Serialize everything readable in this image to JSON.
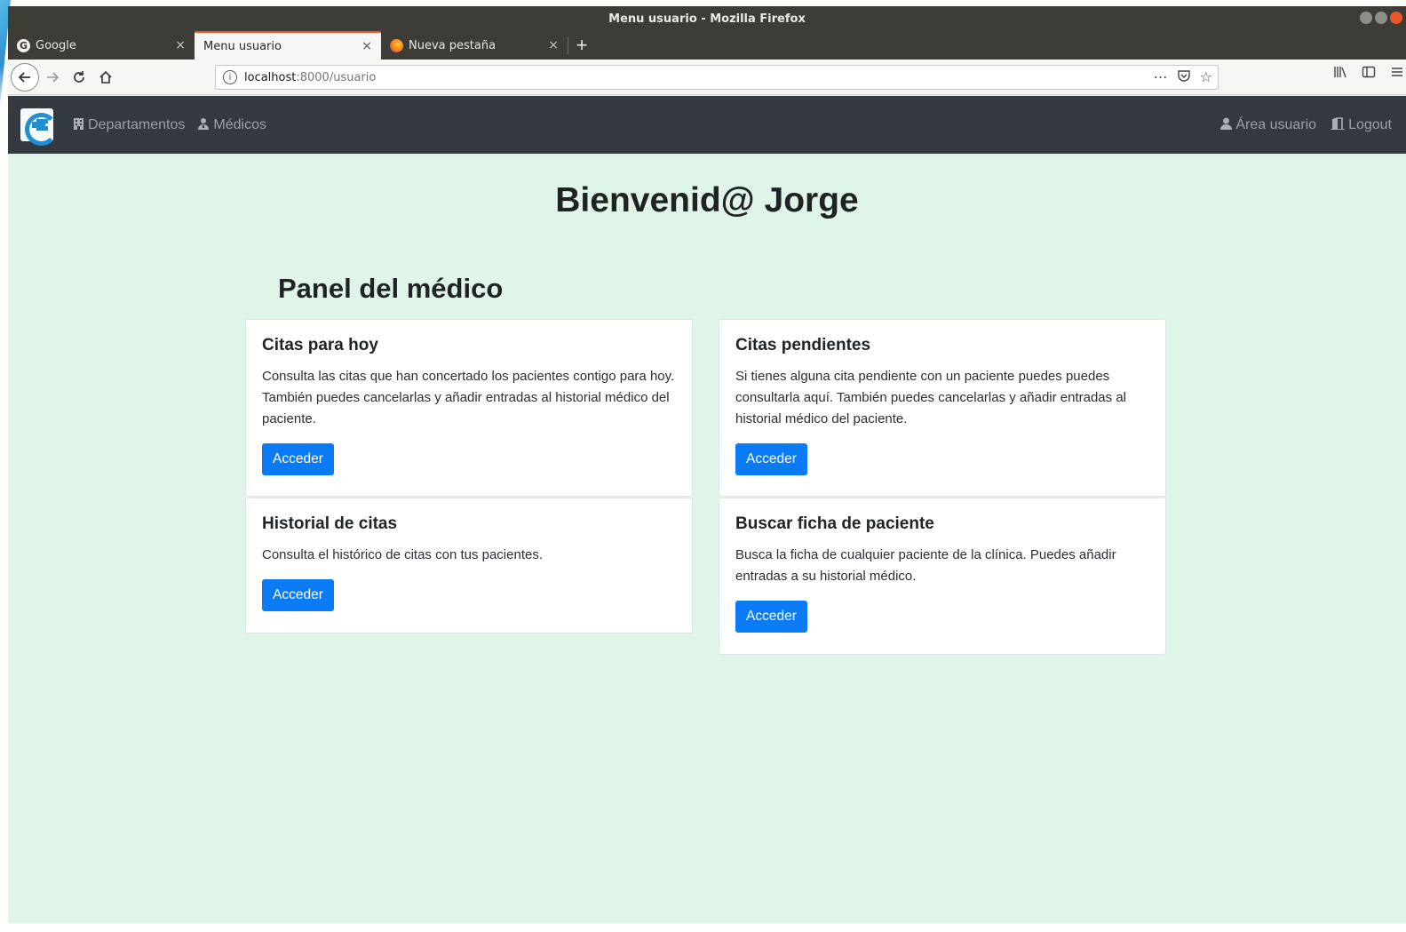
{
  "window": {
    "title": "Menu usuario - Mozilla Firefox"
  },
  "tabs": [
    {
      "label": "Google",
      "close": "×"
    },
    {
      "label": "Menu usuario",
      "close": "×"
    },
    {
      "label": "Nueva pestaña",
      "close": "×"
    }
  ],
  "url": {
    "host": "localhost",
    "rest": ":8000/usuario"
  },
  "site": {
    "nav_departamentos": "Departamentos",
    "nav_medicos": "Médicos",
    "area_usuario": "Área usuario",
    "logout": "Logout"
  },
  "main": {
    "welcome": "Bienvenid@ Jorge",
    "panel_title": "Panel del médico",
    "cards": [
      {
        "title": "Citas para hoy",
        "text": "Consulta las citas que han concertado los pacientes contigo para hoy. También puedes cancelarlas y añadir entradas al historial médico del paciente.",
        "button": "Acceder"
      },
      {
        "title": "Citas pendientes",
        "text": "Si tienes alguna cita pendiente con un paciente puedes puedes consultarla aquí. También puedes cancelarlas y añadir entradas al historial médico del paciente.",
        "button": "Acceder"
      },
      {
        "title": "Historial de citas",
        "text": "Consulta el histórico de citas con tus pacientes.",
        "button": "Acceder"
      },
      {
        "title": "Buscar ficha de paciente",
        "text": "Busca la ficha de cualquier paciente de la clínica. Puedes añadir entradas a su historial médico.",
        "button": "Acceder"
      }
    ]
  },
  "colors": {
    "page_bg": "#dff5e7",
    "header_bg": "#343a40",
    "button_bg": "#0b7bf5",
    "active_tab_accent": "#e8572c"
  }
}
